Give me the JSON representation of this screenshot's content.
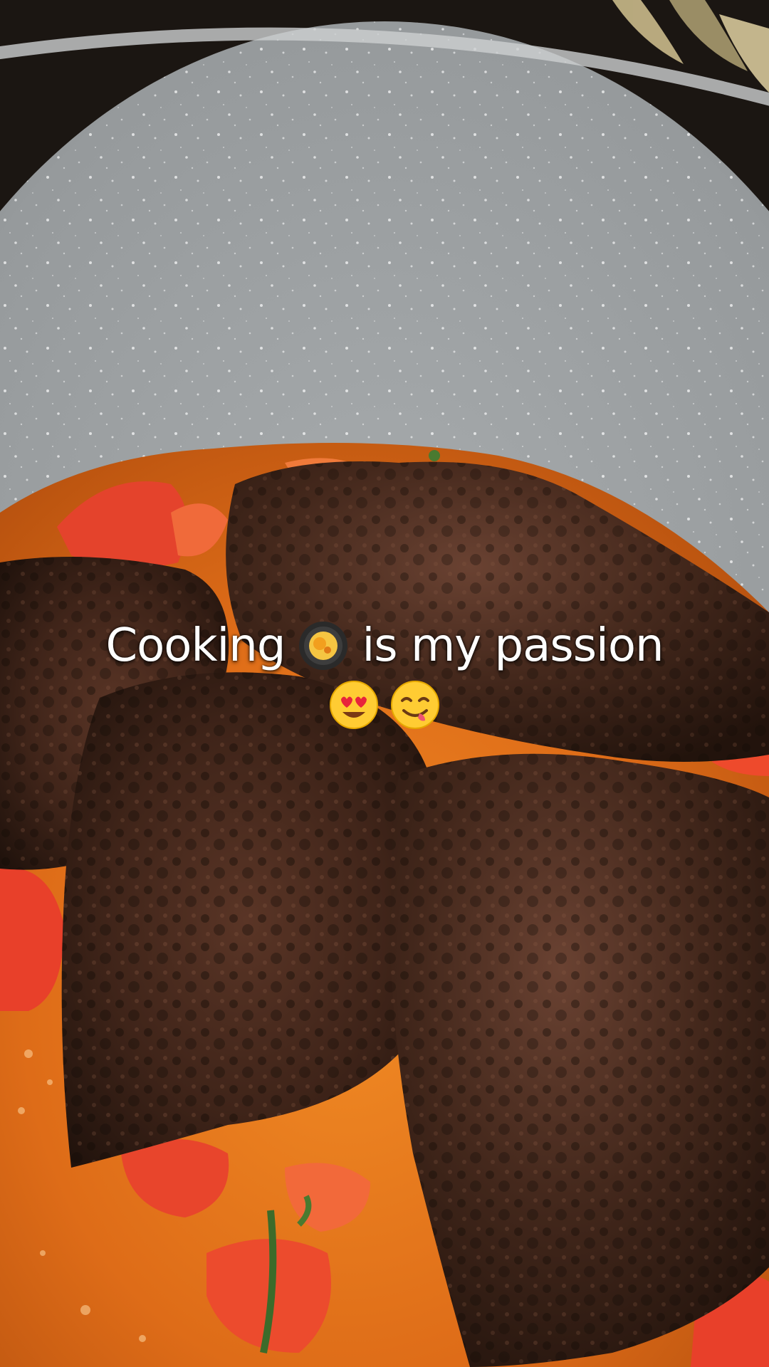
{
  "caption": {
    "word_before": "Cooking",
    "word_after": "is my passion",
    "emoji_inline": "cooking-pan-emoji",
    "emoji_line": [
      "heart-eyes-emoji",
      "yum-face-emoji"
    ]
  },
  "colors": {
    "pan": "#9b9fa1",
    "pan_rim": "#c6c9ca",
    "sauce": "#e0771c",
    "tomato": "#e8402a",
    "steak": "#4a2a1e",
    "steak_dark": "#1f120c"
  }
}
